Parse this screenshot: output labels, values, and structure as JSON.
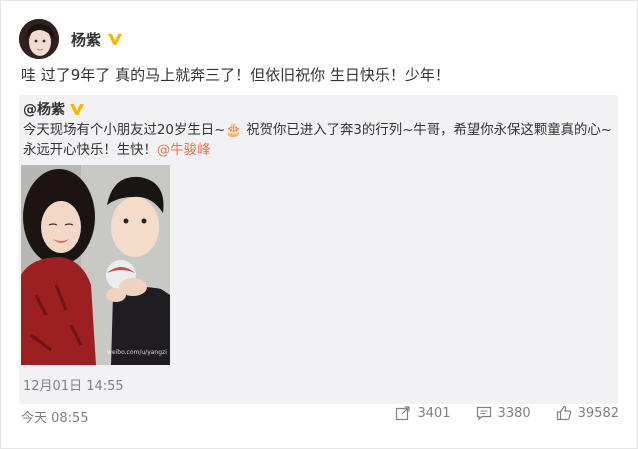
{
  "post": {
    "username": "杨紫",
    "text": "哇 过了9年了 真的马上就奔三了！但依旧祝你 生日快乐！少年！",
    "time": "今天 08:55"
  },
  "repost": {
    "username": "@杨紫",
    "text_before": "今天现场有个小朋友过20岁生日~🎂 祝贺你已进入了奔3的行列~牛哥，希望你永保这颗童真的心~永远开心快乐！生快！",
    "mention": "@牛骏峰",
    "time": "12月01日 14:55",
    "image_watermark": "weibo.com/u/yangzi"
  },
  "actions": {
    "repost_count": "3401",
    "comment_count": "3380",
    "like_count": "39582"
  },
  "colors": {
    "accent": "#eb7350",
    "verified_badge": "#ffb400",
    "repost_bg": "#f2f2f5",
    "muted_text": "#808080"
  },
  "icons": [
    "avatar",
    "verified-badge-icon",
    "repost-icon",
    "comment-icon",
    "like-icon"
  ]
}
